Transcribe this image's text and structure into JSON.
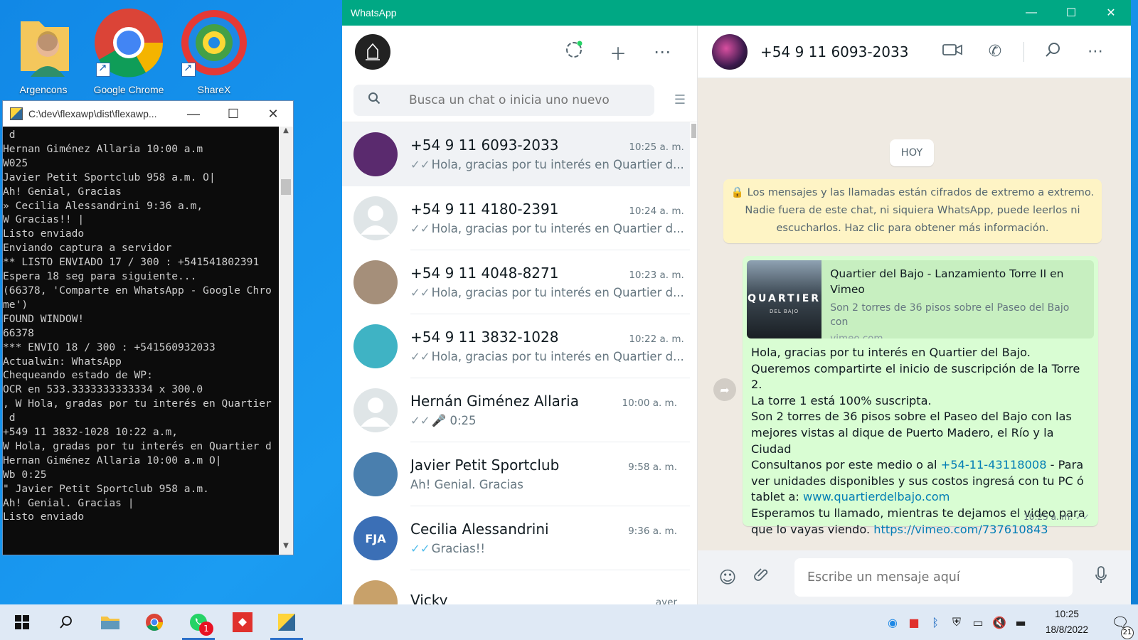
{
  "desktop": {
    "icons": [
      {
        "label": "Argencons"
      },
      {
        "label": "Google Chrome"
      },
      {
        "label": "ShareX"
      }
    ]
  },
  "console": {
    "title": "C:\\dev\\flexawp\\dist\\flexawp...",
    "lines": [
      " d",
      "Hernan Giménez Allaria 10:00 a.m",
      "W025",
      "Javier Petit Sportclub 958 a.m. O|",
      "Ah! Genial, Gracias",
      "» Cecilia Alessandrini 9:36 a.m,",
      "W Gracias!! |",
      "Listo enviado",
      "Enviando captura a servidor",
      "** LISTO ENVIADO 17 / 300 : +541541802391",
      "Espera 18 seg para siguiente...",
      "(66378, 'Comparte en WhatsApp - Google Chro",
      "me')",
      "FOUND WINDOW!",
      "66378",
      "*** ENVIO 18 / 300 : +541560932033",
      "Actualwin: WhatsApp",
      "Chequeando estado de WP:",
      "OCR en 533.3333333333334 x 300.0",
      ", W Hola, gradas por tu interés en Quartier",
      " d",
      "+549 11 3832-1028 10:22 a.m,",
      "W Hola, gradas por tu interés en Quartier d",
      "",
      "Hernan Giménez Allaria 10:00 a.m O|",
      "Wb 0:25",
      "\" Javier Petit Sportclub 958 a.m.",
      "Ah! Genial. Gracias |",
      "Listo enviado"
    ]
  },
  "whatsapp": {
    "window_title": "WhatsApp",
    "search_placeholder": "Busca un chat o inicia uno nuevo",
    "chats": [
      {
        "name": "+54 9 11 6093-2033",
        "time": "10:25 a. m.",
        "tick": "✓✓",
        "preview": "Hola, gracias por tu interés en Quartier d...",
        "avatar_color": "#5a2a6e"
      },
      {
        "name": "+54 9 11 4180-2391",
        "time": "10:24 a. m.",
        "tick": "✓✓",
        "preview": "Hola, gracias por tu interés en Quartier d...",
        "avatar_color": "#dfe5e7"
      },
      {
        "name": "+54 9 11 4048-8271",
        "time": "10:23 a. m.",
        "tick": "✓✓",
        "preview": "Hola, gracias por tu interés en Quartier d...",
        "avatar_color": "#a58f7a"
      },
      {
        "name": "+54 9 11 3832-1028",
        "time": "10:22 a. m.",
        "tick": "✓✓",
        "preview": "Hola, gracias por tu interés en Quartier d...",
        "avatar_color": "#3fb3c4"
      },
      {
        "name": "Hernán Giménez Allaria",
        "time": "10:00 a. m.",
        "tick": "✓✓",
        "preview": "🎤 0:25",
        "avatar_color": "#dfe5e7"
      },
      {
        "name": "Javier Petit Sportclub",
        "time": "9:58 a. m.",
        "tick": "",
        "preview": "Ah!  Genial. Gracias",
        "avatar_color": "#4a7fae"
      },
      {
        "name": "Cecilia Alessandrini",
        "time": "9:36 a. m.",
        "tick": "✓✓",
        "preview": "Gracias!!",
        "avatar_color": "#3b6fb6",
        "avatar_text": "FJA"
      },
      {
        "name": "Vicky",
        "time": "ayer",
        "tick": "",
        "preview": "",
        "avatar_color": "#c8a16a"
      }
    ],
    "conversation": {
      "name": "+54 9 11 6093-2033",
      "day_label": "HOY",
      "encryption_notice": "🔒 Los mensajes y las llamadas están cifrados de extremo a extremo. Nadie fuera de este chat, ni siquiera WhatsApp, puede leerlos ni escucharlos. Haz clic para obtener más información.",
      "link_preview": {
        "title": "Quartier del Bajo - Lanzamiento Torre II en Vimeo",
        "description": "Son 2 torres de 36 pisos sobre el Paseo del Bajo con",
        "host": "vimeo.com",
        "thumb_text": "QUARTIER",
        "thumb_sub": "DEL BAJO"
      },
      "message": {
        "line1": "Hola, gracias por tu interés en Quartier del Bajo.",
        "line2": "Queremos compartirte el inicio de suscripción de la Torre 2.",
        "line3": "La torre 1 está 100% suscripta.",
        "line4": "Son 2 torres de 36 pisos sobre el Paseo del Bajo con las mejores vistas al dique de Puerto Madero, el Río y la Ciudad",
        "line5_pre": "Consultanos por este medio o al ",
        "phone_link": "+54-11-43118008",
        "line5_post": " - Para ver unidades disponibles y sus costos ingresá con tu PC ó tablet a: ",
        "site_link": "www.quartierdelbajo.com",
        "line6": "Esperamos tu llamado, mientras te dejamos el video para que lo vayas viendo. ",
        "video_link": "https://vimeo.com/737610843",
        "time": "10:25 a. m.",
        "tick": "✓✓"
      },
      "composer_placeholder": "Escribe un mensaje aquí"
    }
  },
  "taskbar": {
    "time": "10:25",
    "date": "18/8/2022",
    "whatsapp_badge": "1",
    "notification_count": "21"
  }
}
